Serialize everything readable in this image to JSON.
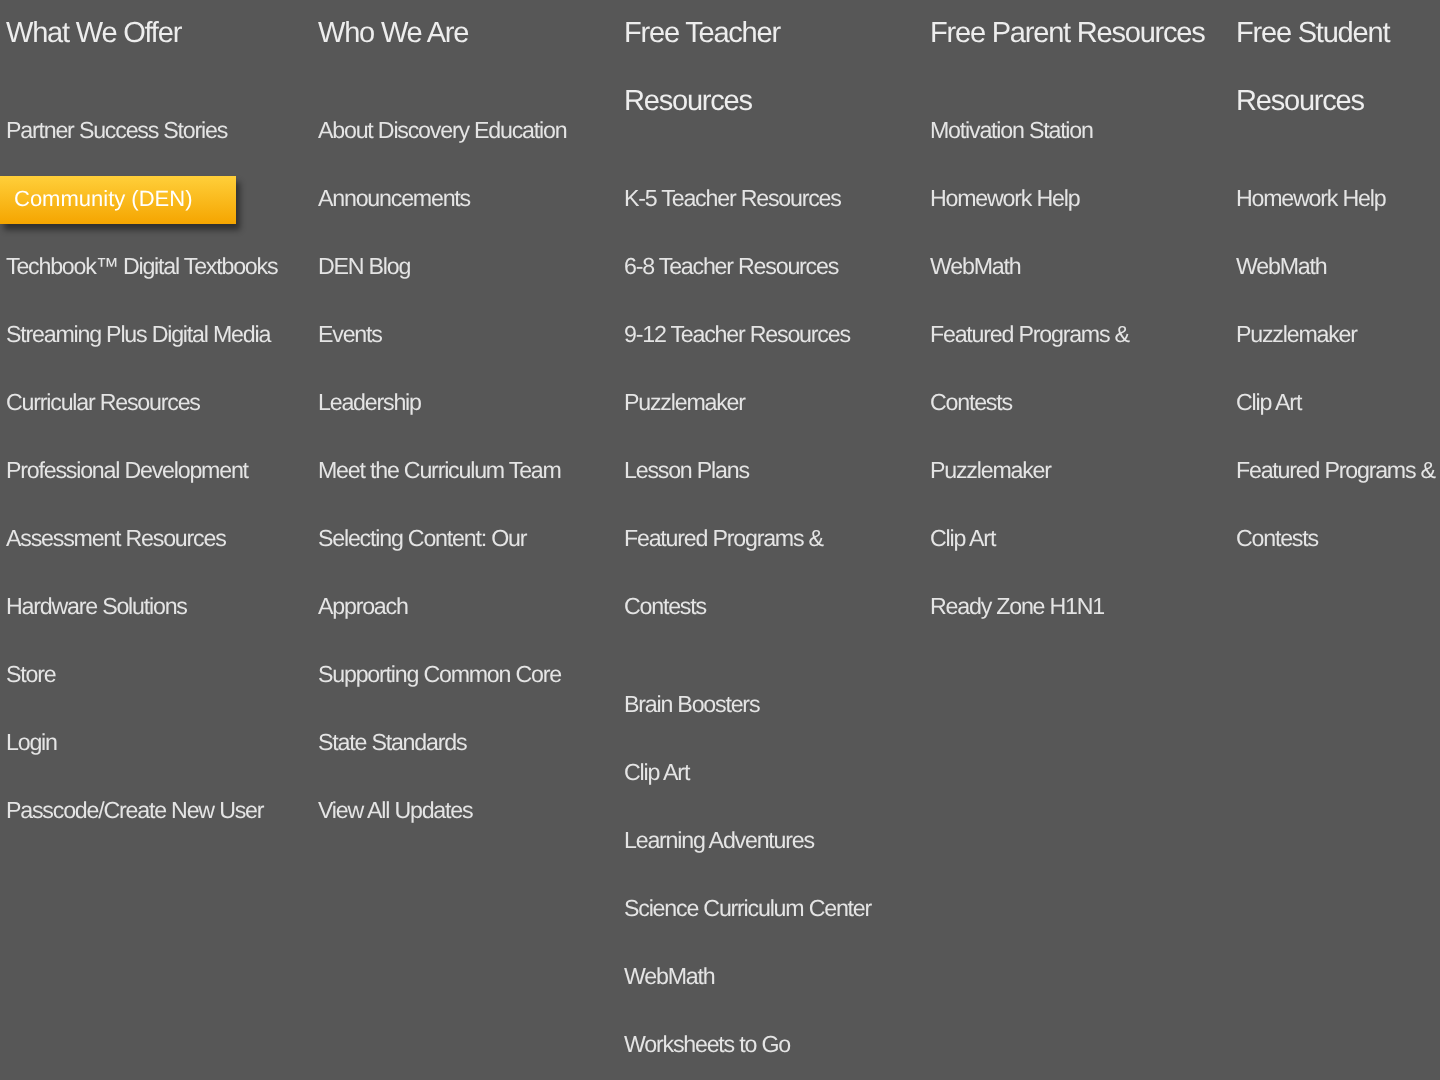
{
  "columns": [
    {
      "heading": [
        "What We Offer"
      ],
      "groups": [
        [
          {
            "lines": [
              "Partner Success Stories"
            ],
            "selected": false
          },
          {
            "lines": [
              "Community (DEN)"
            ],
            "selected": true
          },
          {
            "lines": [
              "Techbook™ Digital Textbooks"
            ],
            "selected": false
          },
          {
            "lines": [
              "Streaming Plus Digital Media"
            ],
            "selected": false
          },
          {
            "lines": [
              "Curricular Resources"
            ],
            "selected": false
          },
          {
            "lines": [
              "Professional Development"
            ],
            "selected": false
          },
          {
            "lines": [
              "Assessment Resources"
            ],
            "selected": false
          },
          {
            "lines": [
              "Hardware Solutions"
            ],
            "selected": false
          },
          {
            "lines": [
              "Store"
            ],
            "selected": false
          },
          {
            "lines": [
              "Login"
            ],
            "selected": false
          },
          {
            "lines": [
              "Passcode/Create New User"
            ],
            "selected": false
          }
        ]
      ]
    },
    {
      "heading": [
        "Who We Are"
      ],
      "groups": [
        [
          {
            "lines": [
              "About Discovery Education"
            ],
            "selected": false
          },
          {
            "lines": [
              "Announcements"
            ],
            "selected": false
          },
          {
            "lines": [
              "DEN Blog"
            ],
            "selected": false
          },
          {
            "lines": [
              "Events"
            ],
            "selected": false
          },
          {
            "lines": [
              "Leadership"
            ],
            "selected": false
          },
          {
            "lines": [
              "Meet the Curriculum Team"
            ],
            "selected": false
          },
          {
            "lines": [
              "Selecting Content: Our",
              "Approach"
            ],
            "selected": false
          },
          {
            "lines": [
              "Supporting Common Core"
            ],
            "selected": false
          },
          {
            "lines": [
              "State Standards"
            ],
            "selected": false
          },
          {
            "lines": [
              "View All Updates"
            ],
            "selected": false
          }
        ]
      ]
    },
    {
      "heading": [
        "Free Teacher",
        "Resources"
      ],
      "groups": [
        [
          {
            "lines": [
              "K-5 Teacher Resources"
            ],
            "selected": false
          },
          {
            "lines": [
              "6-8 Teacher Resources"
            ],
            "selected": false
          },
          {
            "lines": [
              "9-12 Teacher Resources"
            ],
            "selected": false
          },
          {
            "lines": [
              "Puzzlemaker"
            ],
            "selected": false
          },
          {
            "lines": [
              "Lesson Plans"
            ],
            "selected": false
          },
          {
            "lines": [
              "Featured Programs &",
              "Contests"
            ],
            "selected": false
          }
        ],
        [
          {
            "lines": [
              "Brain Boosters"
            ],
            "selected": false
          },
          {
            "lines": [
              "Clip Art"
            ],
            "selected": false
          },
          {
            "lines": [
              "Learning Adventures"
            ],
            "selected": false
          },
          {
            "lines": [
              "Science Curriculum Center"
            ],
            "selected": false
          },
          {
            "lines": [
              "WebMath"
            ],
            "selected": false
          },
          {
            "lines": [
              "Worksheets to Go"
            ],
            "selected": false
          }
        ]
      ]
    },
    {
      "heading": [
        "Free Parent Resources"
      ],
      "groups": [
        [
          {
            "lines": [
              "Motivation Station"
            ],
            "selected": false
          },
          {
            "lines": [
              "Homework Help"
            ],
            "selected": false
          },
          {
            "lines": [
              "WebMath"
            ],
            "selected": false
          },
          {
            "lines": [
              "Featured Programs &",
              "Contests"
            ],
            "selected": false
          },
          {
            "lines": [
              "Puzzlemaker"
            ],
            "selected": false
          },
          {
            "lines": [
              "Clip Art"
            ],
            "selected": false
          },
          {
            "lines": [
              "Ready Zone H1N1"
            ],
            "selected": false
          }
        ]
      ]
    },
    {
      "heading": [
        "Free Student",
        "Resources"
      ],
      "groups": [
        [
          {
            "lines": [
              "Homework Help"
            ],
            "selected": false
          },
          {
            "lines": [
              "WebMath"
            ],
            "selected": false
          },
          {
            "lines": [
              "Puzzlemaker"
            ],
            "selected": false
          },
          {
            "lines": [
              "Clip Art"
            ],
            "selected": false
          },
          {
            "lines": [
              "Featured Programs &",
              "Contests"
            ],
            "selected": false
          }
        ]
      ]
    }
  ]
}
